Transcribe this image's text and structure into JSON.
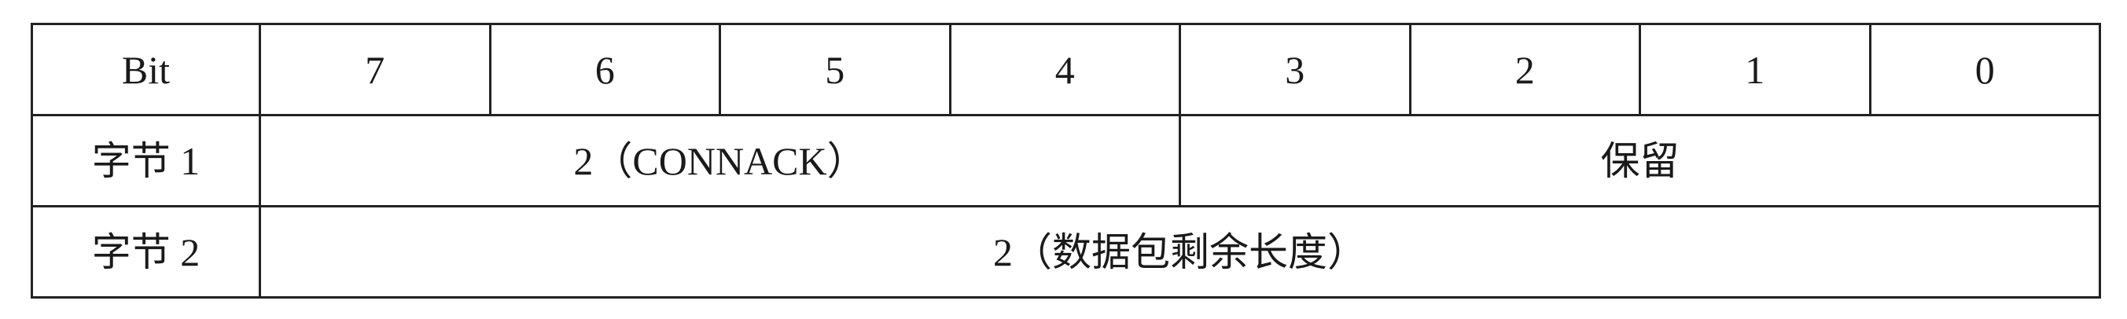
{
  "table": {
    "header": {
      "label": "Bit",
      "bits": [
        "7",
        "6",
        "5",
        "4",
        "3",
        "2",
        "1",
        "0"
      ]
    },
    "rows": [
      {
        "label": "字节 1",
        "high_nibble": "2（CONNACK）",
        "low_nibble": "保留"
      },
      {
        "label": "字节 2",
        "value": "2（数据包剩余长度）"
      }
    ]
  }
}
